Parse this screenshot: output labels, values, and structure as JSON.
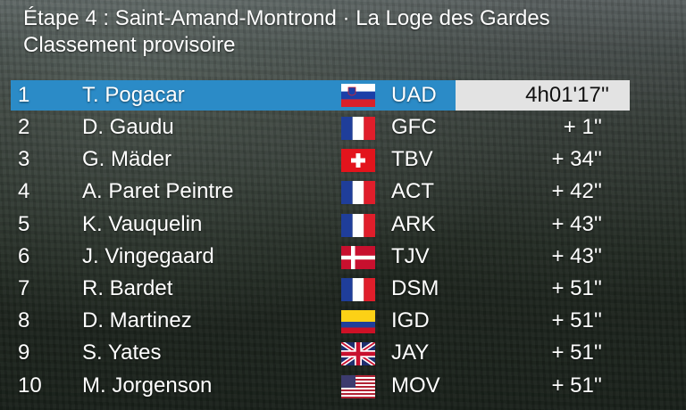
{
  "header": {
    "title": "Étape 4 : Saint-Amand-Montrond · La Loge des Gardes",
    "subtitle": "Classement provisoire"
  },
  "standings": [
    {
      "rank": "1",
      "name": "T. Pogacar",
      "flag": "slovenia-flag-icon",
      "team": "UAD",
      "time": "4h01'17''"
    },
    {
      "rank": "2",
      "name": "D. Gaudu",
      "flag": "france-flag-icon",
      "team": "GFC",
      "time": "+ 1''"
    },
    {
      "rank": "3",
      "name": "G. Mäder",
      "flag": "switzerland-flag-icon",
      "team": "TBV",
      "time": "+ 34''"
    },
    {
      "rank": "4",
      "name": "A. Paret Peintre",
      "flag": "france-flag-icon",
      "team": "ACT",
      "time": "+ 42''"
    },
    {
      "rank": "5",
      "name": "K. Vauquelin",
      "flag": "france-flag-icon",
      "team": "ARK",
      "time": "+ 43''"
    },
    {
      "rank": "6",
      "name": "J. Vingegaard",
      "flag": "denmark-flag-icon",
      "team": "TJV",
      "time": "+ 43''"
    },
    {
      "rank": "7",
      "name": "R. Bardet",
      "flag": "france-flag-icon",
      "team": "DSM",
      "time": "+ 51''"
    },
    {
      "rank": "8",
      "name": "D. Martinez",
      "flag": "colombia-flag-icon",
      "team": "IGD",
      "time": "+ 51''"
    },
    {
      "rank": "9",
      "name": "S. Yates",
      "flag": "uk-flag-icon",
      "team": "JAY",
      "time": "+ 51''"
    },
    {
      "rank": "10",
      "name": "M. Jorgenson",
      "flag": "usa-flag-icon",
      "team": "MOV",
      "time": "+ 51''"
    }
  ],
  "colors": {
    "highlight_blue": "#2b8bc7",
    "highlight_grey": "#e3e3e3",
    "text": "#ffffff"
  }
}
